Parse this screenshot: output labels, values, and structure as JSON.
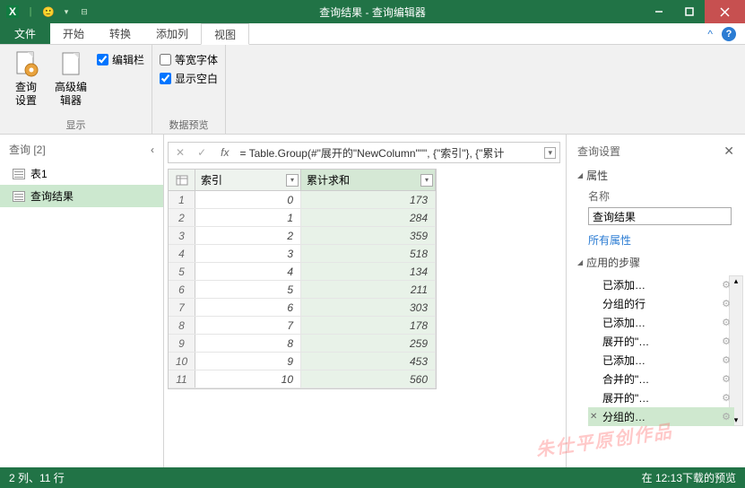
{
  "window": {
    "title": "查询结果 - 查询编辑器"
  },
  "tabs": {
    "file": "文件",
    "start": "开始",
    "transform": "转换",
    "add": "添加列",
    "view": "视图"
  },
  "ribbon": {
    "group1_label": "显示",
    "btn_query_settings_l1": "查询",
    "btn_query_settings_l2": "设置",
    "btn_adv_l1": "高级编",
    "btn_adv_l2": "辑器",
    "chk_formula": "编辑栏",
    "group2_label": "数据预览",
    "chk_mono": "等宽字体",
    "chk_blank": "显示空白"
  },
  "queries": {
    "header": "查询 [2]",
    "items": [
      "表1",
      "查询结果"
    ],
    "selected": 1
  },
  "formula": "= Table.Group(#\"展开的\"NewColumn\"\"\", {\"索引\"}, {\"累计",
  "columns": [
    "索引",
    "累计求和"
  ],
  "rows": [
    {
      "n": 1,
      "a": 0,
      "b": 173
    },
    {
      "n": 2,
      "a": 1,
      "b": 284
    },
    {
      "n": 3,
      "a": 2,
      "b": 359
    },
    {
      "n": 4,
      "a": 3,
      "b": 518
    },
    {
      "n": 5,
      "a": 4,
      "b": 134
    },
    {
      "n": 6,
      "a": 5,
      "b": 211
    },
    {
      "n": 7,
      "a": 6,
      "b": 303
    },
    {
      "n": 8,
      "a": 7,
      "b": 178
    },
    {
      "n": 9,
      "a": 8,
      "b": 259
    },
    {
      "n": 10,
      "a": 9,
      "b": 453
    },
    {
      "n": 11,
      "a": 10,
      "b": 560
    }
  ],
  "settings": {
    "title": "查询设置",
    "sec_props": "属性",
    "name_label": "名称",
    "name_value": "查询结果",
    "all_props": "所有属性",
    "sec_steps": "应用的步骤",
    "steps": [
      "已添加…",
      "分组的行",
      "已添加…",
      "展开的\"…",
      "已添加…",
      "合并的\"…",
      "展开的\"…",
      "分组的…"
    ],
    "selected_step": 7
  },
  "status": {
    "left": "2 列、11 行",
    "right": "在 12:13下载的预览"
  },
  "watermark": "朱仕平原创作品"
}
